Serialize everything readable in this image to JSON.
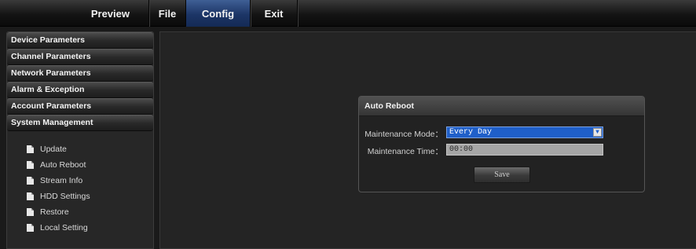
{
  "nav": {
    "tabs": [
      {
        "label": "Preview"
      },
      {
        "label": "File"
      },
      {
        "label": "Config",
        "active": true
      },
      {
        "label": "Exit"
      }
    ]
  },
  "sidebar": {
    "sections": [
      {
        "label": "Device Parameters"
      },
      {
        "label": "Channel Parameters"
      },
      {
        "label": "Network Parameters"
      },
      {
        "label": "Alarm & Exception"
      },
      {
        "label": "Account Parameters"
      },
      {
        "label": "System Management"
      }
    ],
    "subitems": [
      {
        "label": "Update",
        "icon": "document-icon"
      },
      {
        "label": "Auto Reboot",
        "icon": "document-icon"
      },
      {
        "label": "Stream Info",
        "icon": "document-icon"
      },
      {
        "label": "HDD Settings",
        "icon": "document-icon"
      },
      {
        "label": "Restore",
        "icon": "document-icon"
      },
      {
        "label": "Local Setting",
        "icon": "document-icon"
      }
    ]
  },
  "panel": {
    "title": "Auto Reboot",
    "mode_label": "Maintenance Mode：",
    "mode_value": "Every Day",
    "time_label": "Maintenance Time：",
    "time_value": "00:00",
    "save_label": "Save"
  },
  "colors": {
    "active_tab": "#1c3566",
    "select_bg": "#1f5fc9"
  }
}
